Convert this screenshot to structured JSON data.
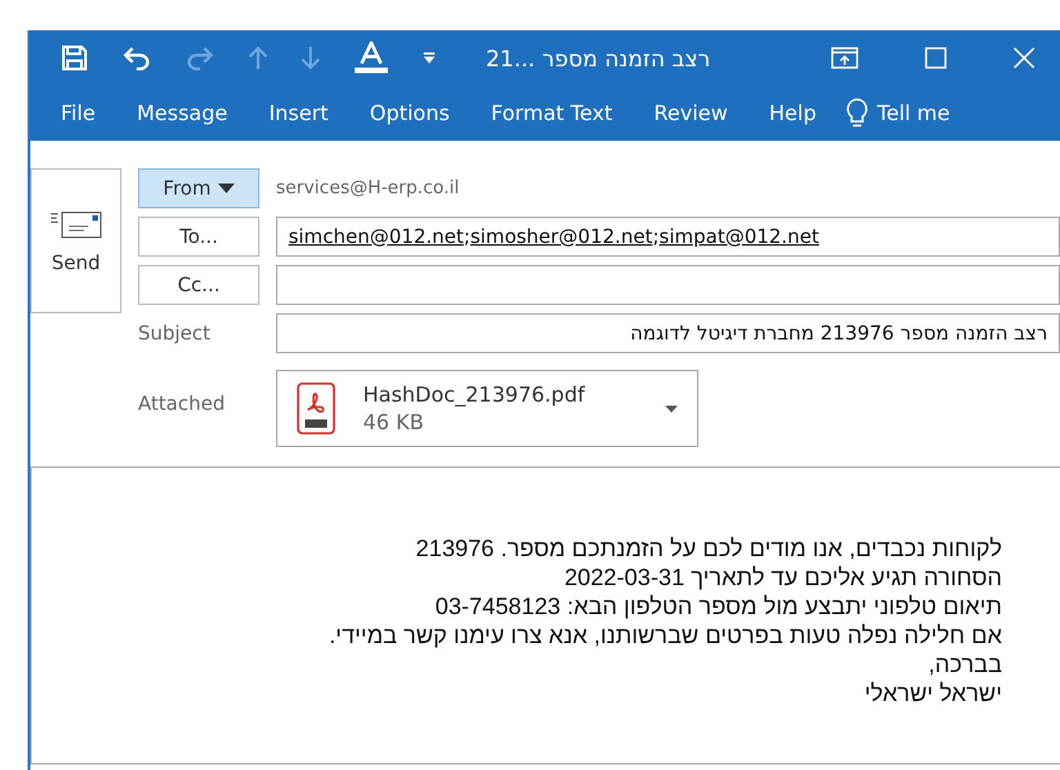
{
  "window": {
    "title": "רצב הזמנה מספר ...21"
  },
  "quick_access": [
    {
      "kind": "save",
      "disabled": false
    },
    {
      "kind": "undo",
      "disabled": false
    },
    {
      "kind": "redo",
      "disabled": true
    },
    {
      "kind": "up",
      "disabled": true
    },
    {
      "kind": "down",
      "disabled": true
    },
    {
      "kind": "font-color",
      "disabled": false
    },
    {
      "kind": "customize",
      "disabled": false
    }
  ],
  "ribbon_tabs": [
    {
      "label": "File",
      "selected": false
    },
    {
      "label": "Message",
      "selected": false
    },
    {
      "label": "Insert",
      "selected": false
    },
    {
      "label": "Options",
      "selected": false
    },
    {
      "label": "Format Text",
      "selected": false
    },
    {
      "label": "Review",
      "selected": false
    },
    {
      "label": "Help",
      "selected": false
    }
  ],
  "tell_me": "Tell me",
  "send": "Send",
  "from": {
    "label": "From",
    "value": "services@H-erp.co.il"
  },
  "to": {
    "label": "To...",
    "recipients": [
      "simchen@012.net",
      "simosher@012.net",
      "simpat@012.net"
    ],
    "separator": ";"
  },
  "cc": {
    "label": "Cc..."
  },
  "subject": {
    "label": "Subject",
    "value": "רצב הזמנה מספר 213976 מחברת דיגיטל לדוגמה"
  },
  "attached": {
    "label": "Attached",
    "file": "HashDoc_213976.pdf",
    "size": "46 KB"
  },
  "body": [
    "לקוחות נכבדים, אנו מודים לכם על הזמנתכם מספר. 213976",
    "הסחורה תגיע אליכם עד לתאריך 2022-03-31",
    "תיאום טלפוני יתבצע מול מספר הטלפון הבא: 03-7458123",
    "אם חלילה נפלה טעות בפרטים שברשותנו, אנא צרו עימנו קשר במיידי.",
    "בברכה,",
    "ישראל ישראלי"
  ]
}
